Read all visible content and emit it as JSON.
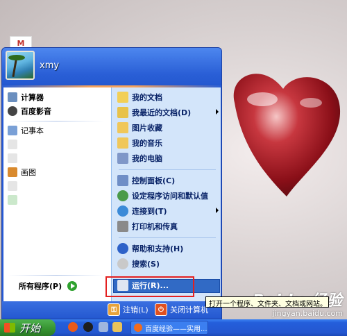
{
  "user": {
    "name": "xmy"
  },
  "start_menu": {
    "left_pinned": [
      {
        "label": "计算器",
        "icon": "calculator-icon",
        "color": "#6b8fbf"
      },
      {
        "label": "百度影音",
        "icon": "baidu-player-icon",
        "color": "#444444"
      }
    ],
    "left_recent": [
      {
        "label": "记事本",
        "icon": "notepad-icon",
        "color": "#7aa0d6"
      },
      {
        "label": "画图",
        "icon": "paint-icon",
        "color": "#d98a2e"
      }
    ],
    "all_programs": "所有程序(P)",
    "right_items": [
      {
        "label": "我的文档",
        "icon": "my-documents-icon",
        "color": "#f2cf56"
      },
      {
        "label": "我最近的文档(D)",
        "icon": "recent-documents-icon",
        "color": "#e8c24a",
        "submenu": true
      },
      {
        "label": "图片收藏",
        "icon": "my-pictures-icon",
        "color": "#f0c75a"
      },
      {
        "label": "我的音乐",
        "icon": "my-music-icon",
        "color": "#f0c75a"
      },
      {
        "label": "我的电脑",
        "icon": "my-computer-icon",
        "color": "#7f97c8"
      },
      {
        "label": "控制面板(C)",
        "icon": "control-panel-icon",
        "color": "#6f8ec6"
      },
      {
        "label": "设定程序访问和默认值",
        "icon": "program-defaults-icon",
        "color": "#4a9a4a"
      },
      {
        "label": "连接到(T)",
        "icon": "connect-to-icon",
        "color": "#3b8ad8",
        "submenu": true
      },
      {
        "label": "打印机和传真",
        "icon": "printer-icon",
        "color": "#8a8a8a"
      },
      {
        "label": "帮助和支持(H)",
        "icon": "help-icon",
        "color": "#2d62c9"
      },
      {
        "label": "搜索(S)",
        "icon": "search-icon",
        "color": "#c9c9c9"
      },
      {
        "label": "运行(R)...",
        "icon": "run-icon",
        "color": "#dfe6f2"
      }
    ],
    "footer": {
      "logoff": "注销(L)",
      "shutdown": "关闭计算机"
    }
  },
  "tooltip": "打开一个程序、文件夹、文档或网站。",
  "taskbar": {
    "start": "开始",
    "window_button": "百度经验——实用..."
  },
  "watermark": {
    "logo": "Baidu 经验",
    "url": "jingyan.baidu.com"
  },
  "colors": {
    "highlight": "#316ac5",
    "annotation_box": "#e32020"
  }
}
